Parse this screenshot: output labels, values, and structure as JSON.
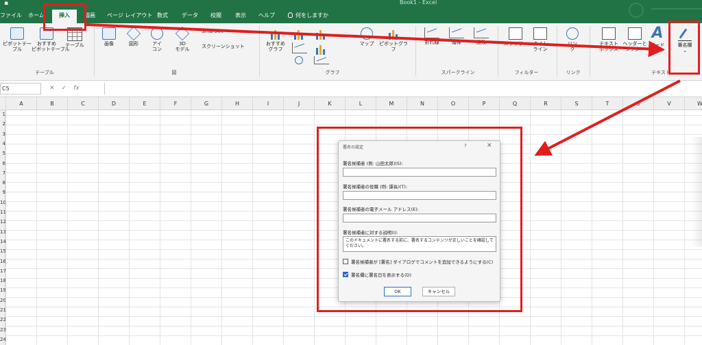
{
  "window": {
    "title": "Book1 - Excel"
  },
  "tabs": [
    {
      "label": "ファイル",
      "active": false
    },
    {
      "label": "ホーム",
      "active": false
    },
    {
      "label": "挿入",
      "active": true
    },
    {
      "label": "描画",
      "active": false
    },
    {
      "label": "ページ レイアウト",
      "active": false
    },
    {
      "label": "数式",
      "active": false
    },
    {
      "label": "データ",
      "active": false
    },
    {
      "label": "校閲",
      "active": false
    },
    {
      "label": "表示",
      "active": false
    },
    {
      "label": "ヘルプ",
      "active": false
    }
  ],
  "tell_me": "何をしますか",
  "ribbon": {
    "groups": {
      "table": "テーブル",
      "illustrations": "図",
      "charts": "グラフ",
      "sparklines": "スパークライン",
      "filters": "フィルター",
      "links": "リンク",
      "text": "テキスト"
    },
    "buttons": {
      "pivot_table": "ピボットテー\nブル",
      "recommended_pivot": "おすすめ\nピボットテーブル",
      "table": "テーブル",
      "pictures": "画像",
      "shapes": "図形",
      "icons": "アイ\nコン",
      "models_3d": "3D\nモデル",
      "smartart": "SmartArt",
      "screenshot": "スクリーンショット",
      "recommended_charts": "おすすめ\nグラフ",
      "maps": "マップ",
      "pivot_chart": "ピボットグラフ",
      "line": "折れ線",
      "column": "縦棒",
      "win_loss": "勝敗",
      "slicer": "スライサー",
      "timeline": "タイム\nライン",
      "link": "リン\nク",
      "text_box": "テキスト\nボックス",
      "header_footer": "ヘッダーと\nフッター",
      "wordart": "ワード\nアート",
      "signature_line": "署名欄"
    }
  },
  "formula_bar": {
    "name_box": "C5",
    "fx": "fx"
  },
  "grid": {
    "columns": [
      "A",
      "B",
      "C",
      "D",
      "E",
      "F",
      "G",
      "H",
      "I",
      "J",
      "K",
      "L",
      "M",
      "N",
      "O",
      "P",
      "Q",
      "R",
      "S",
      "T",
      "U",
      "V",
      "W"
    ],
    "rows": [
      "1",
      "2",
      "3",
      "4",
      "5",
      "6",
      "7",
      "8",
      "9",
      "10",
      "11",
      "12",
      "13",
      "14",
      "15",
      "16",
      "17",
      "18",
      "19",
      "20",
      "21",
      "22",
      "23",
      "24"
    ]
  },
  "dialog": {
    "title": "署名の設定",
    "help": "?",
    "close": "✕",
    "signer_label": "署名候補者 (例: 山田太郎)(S):",
    "signer_value": "",
    "title_label": "署名候補者の役職 (例: 課長)(T):",
    "title_value": "",
    "email_label": "署名候補者の電子メール アドレス(E):",
    "email_value": "",
    "instructions_label": "署名候補者に対する説明(I):",
    "instructions_value": "このドキュメントに署名する前に、署名するコンテンツが正しいことを確認してください。",
    "allow_comments_label": "署名候補者が [署名] ダイアログでコメントを追加できるようにする(C)",
    "allow_comments_checked": false,
    "show_date_label": "署名欄に署名日を表示する(D)",
    "show_date_checked": true,
    "ok": "OK",
    "cancel": "キャンセル"
  },
  "colors": {
    "excel_green": "#217346",
    "annotation_red": "#e01e1e",
    "accent_blue": "#2b6cc4"
  }
}
